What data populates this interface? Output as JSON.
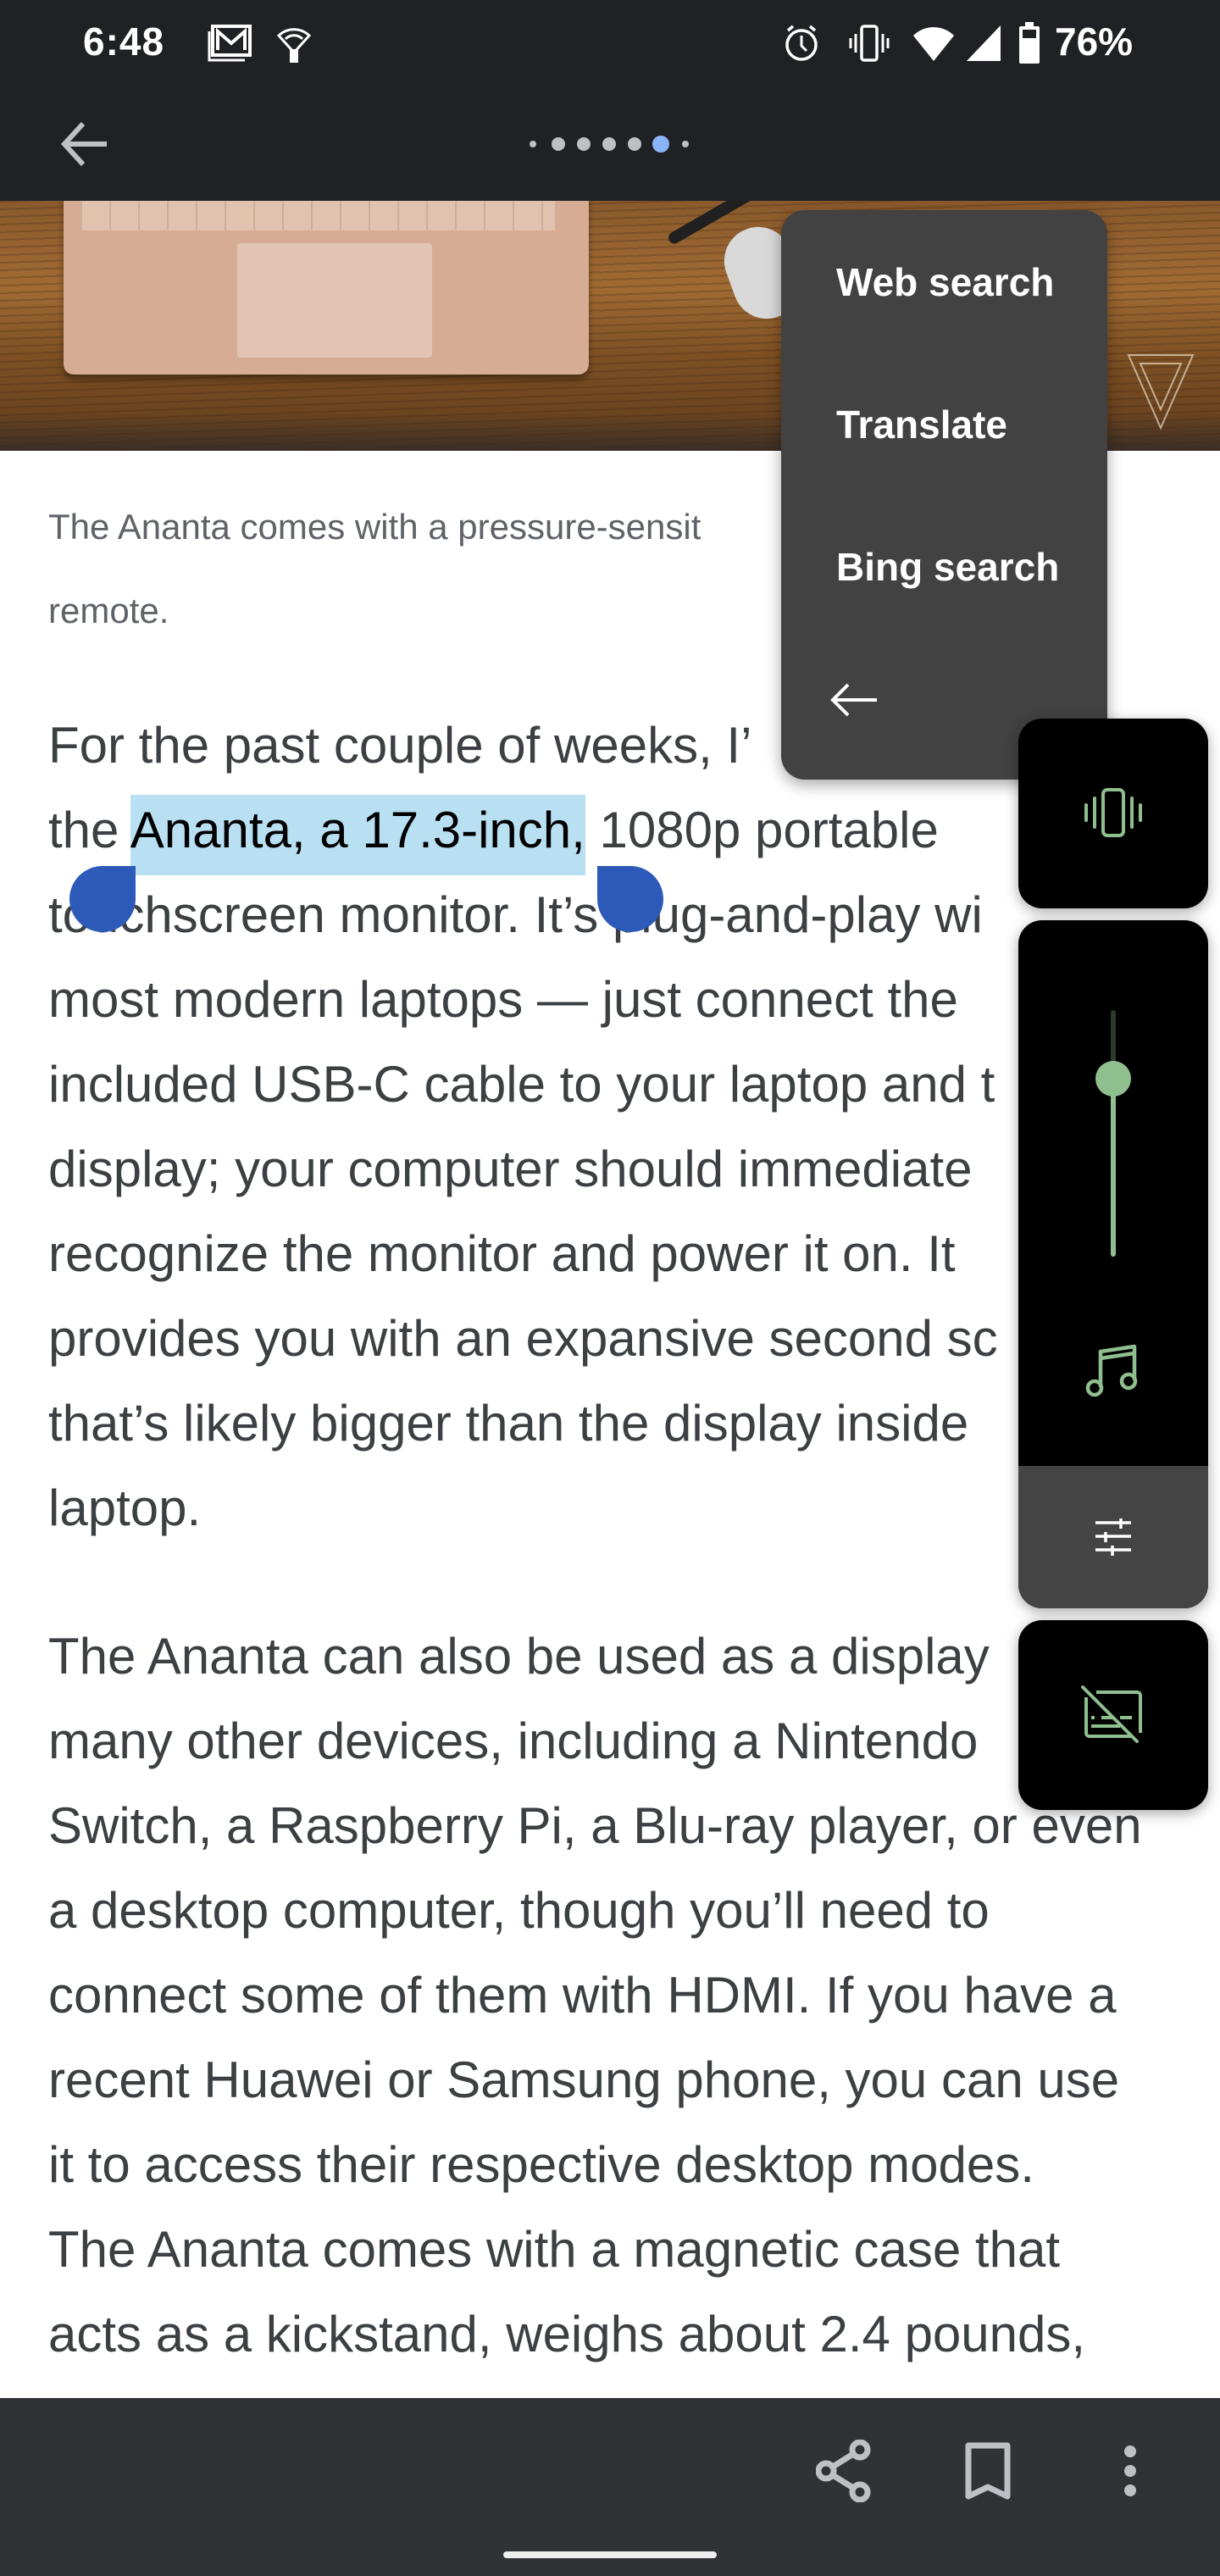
{
  "status_bar": {
    "time": "6:48",
    "left_icons": [
      "gmail-icon",
      "wifi-calling-icon"
    ],
    "right_icons": [
      "alarm-icon",
      "vibrate-icon",
      "wifi-icon",
      "cell-signal-icon",
      "battery-icon"
    ],
    "battery_percent": "76%"
  },
  "app_bar": {
    "back_icon": "arrow-back-icon",
    "page_indicator": {
      "total_dots": 7,
      "active_index": 5
    }
  },
  "article": {
    "image_caption_lines": [
      "The Ananta comes with a pressure-sensit",
      "remote."
    ],
    "paragraph_1": {
      "lines": [
        {
          "pre": "For the past couple of weeks, I’",
          "sel": "",
          "post": ""
        },
        {
          "pre": "the ",
          "sel": "Ananta, a 17.3-inch,",
          "post": " 1080p portable"
        },
        {
          "pre": "touchscreen monitor. It’s plug-and-play wi",
          "sel": "",
          "post": ""
        },
        {
          "pre": "most modern laptops — just connect the",
          "sel": "",
          "post": ""
        },
        {
          "pre": "included USB-C cable to your laptop and t",
          "sel": "",
          "post": ""
        },
        {
          "pre": "display; your computer should immediate",
          "sel": "",
          "post": ""
        },
        {
          "pre": "recognize the monitor and power it on. It",
          "sel": "",
          "post": ""
        },
        {
          "pre": "provides you with an expansive second sc",
          "sel": "",
          "post": ""
        },
        {
          "pre": "that’s likely bigger than the display inside",
          "sel": "",
          "post": ""
        },
        {
          "pre": "laptop.",
          "sel": "",
          "post": ""
        }
      ]
    },
    "paragraph_2": {
      "lines": [
        "The Ananta can also be used as a display",
        "many other devices, including a Nintendo",
        "Switch, a Raspberry Pi, a Blu-ray player, or even",
        "a desktop computer, though you’ll need to",
        "connect some of them with HDMI. If you have a",
        "recent Huawei or Samsung phone, you can use",
        "it to access their respective desktop modes.",
        "The Ananta comes with a magnetic case that",
        "acts as a kickstand, weighs about 2.4 pounds,"
      ]
    },
    "selected_text": "Ananta, a 17.3-inch,"
  },
  "selection_menu": {
    "items": [
      {
        "label": "Web search"
      },
      {
        "label": "Translate"
      },
      {
        "label": "Bing search"
      }
    ],
    "back_icon": "arrow-back-icon"
  },
  "volume_panel": {
    "ringer_mode_icon": "vibrate-icon",
    "stream_icon": "music-note-icon",
    "volume_level": 0.72,
    "settings_icon": "tune-icon",
    "captions_icon": "captions-off-icon",
    "accent_color": "#8fbf8f"
  },
  "bottom_bar": {
    "actions": [
      {
        "name": "share",
        "icon": "share-icon"
      },
      {
        "name": "bookmark",
        "icon": "bookmark-icon"
      },
      {
        "name": "more",
        "icon": "more-vert-icon"
      }
    ]
  },
  "colors": {
    "selection_highlight": "#b9dff3",
    "selection_handle": "#2d5ab9",
    "page_indicator_active": "#8ab4f8",
    "menu_background": "#424242",
    "bars_background": "#202124",
    "bottom_bar_background": "#313236"
  }
}
